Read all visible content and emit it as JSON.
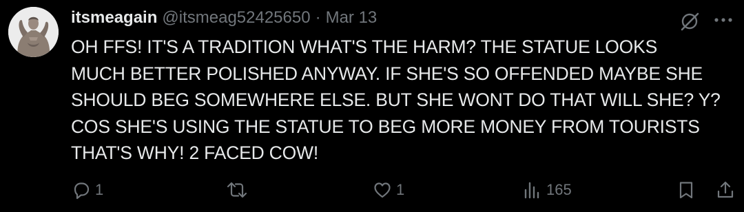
{
  "post": {
    "display_name": "itsmeagain",
    "handle": "@itsmeag52425650",
    "separator": "·",
    "date": "Mar 13",
    "text": "OH FFS! IT'S A TRADITION WHAT'S THE HARM? THE STATUE LOOKS\nMUCH BETTER POLISHED ANYWAY. IF SHE'S SO OFFENDED MAYBE SHE\nSHOULD BEG SOMEWHERE ELSE. BUT SHE WONT DO THAT WILL SHE? Y?\nCOS SHE'S USING THE STATUE TO BEG MORE MONEY FROM TOURISTS\nTHAT'S WHY! 2 FACED COW!"
  },
  "actions": {
    "reply": {
      "icon": "reply-icon",
      "count": "1"
    },
    "retweet": {
      "icon": "retweet-icon",
      "count": ""
    },
    "like": {
      "icon": "heart-icon",
      "count": "1"
    },
    "views": {
      "icon": "views-icon",
      "count": "165"
    },
    "bookmark": {
      "icon": "bookmark-icon"
    },
    "share": {
      "icon": "share-icon"
    }
  },
  "header_icons": {
    "grok": "grok-icon",
    "more": "more-icon"
  },
  "colors": {
    "background": "#000000",
    "text_primary": "#e7e9ea",
    "text_secondary": "#71767b"
  }
}
